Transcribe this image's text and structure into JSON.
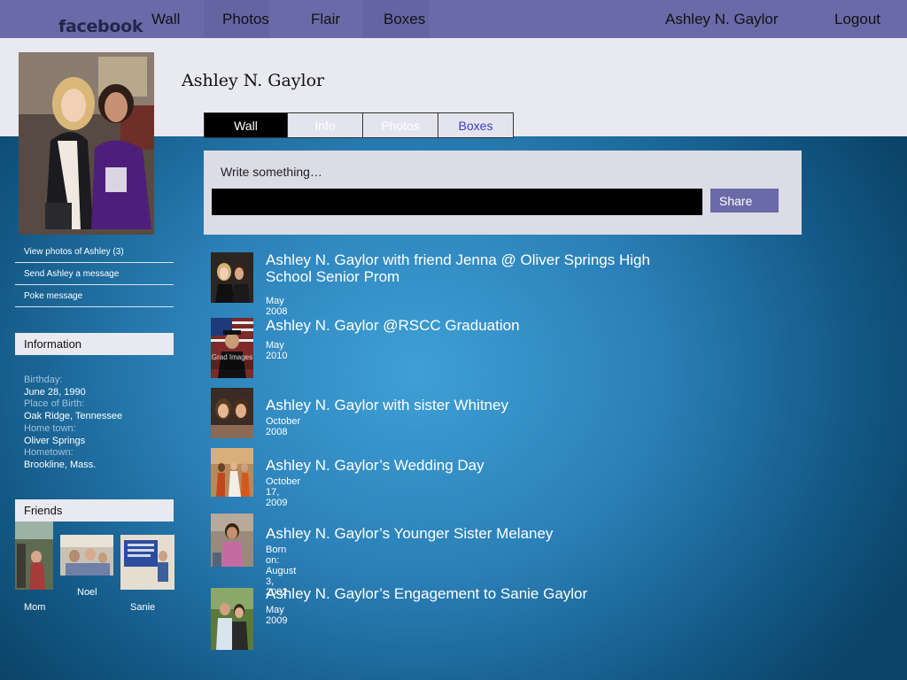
{
  "topbar": {
    "logo": "facebook",
    "nav": [
      "Wall",
      "Photos",
      "Flair",
      "Boxes"
    ],
    "user": "Ashley N. Gaylor",
    "logout": "Logout"
  },
  "profile": {
    "name": "Ashley N. Gaylor",
    "tabs": [
      "Wall",
      "Info",
      "Photos",
      "Boxes"
    ]
  },
  "composer": {
    "prompt": "Write something…",
    "share": "Share"
  },
  "sidebar": {
    "links": [
      "View photos of Ashley (3)",
      "Send Ashley a message",
      "Poke message"
    ],
    "information_header": "Information",
    "info": [
      {
        "label": "Birthday:",
        "value": "June 28, 1990"
      },
      {
        "label": "Place of Birth:",
        "value": "Oak Ridge, Tennessee"
      },
      {
        "label": "Home town:",
        "value": "Oliver Springs"
      },
      {
        "label": "Hometown:",
        "value": "Brookline, Mass."
      }
    ],
    "friends_header": "Friends",
    "friends": [
      "Mom",
      "Noel",
      "Sanie"
    ]
  },
  "posts": [
    {
      "title": "Ashley N. Gaylor  with friend Jenna @ Oliver Springs High School Senior Prom",
      "date": "May 2008"
    },
    {
      "title": "Ashley N. Gaylor @RSCC Graduation",
      "date": "May 2010"
    },
    {
      "title": "Ashley N. Gaylor with sister Whitney",
      "date": "October 2008"
    },
    {
      "title": "Ashley N. Gaylor’s Wedding Day",
      "date": "October 17, 2009"
    },
    {
      "title": "Ashley N. Gaylor’s Younger Sister Melaney",
      "date": "Born on: August 3, 2002"
    },
    {
      "title": "Ashley N. Gaylor’s Engagement to Sanie Gaylor",
      "date": "May 2009"
    }
  ],
  "watermark": "Grad Images"
}
